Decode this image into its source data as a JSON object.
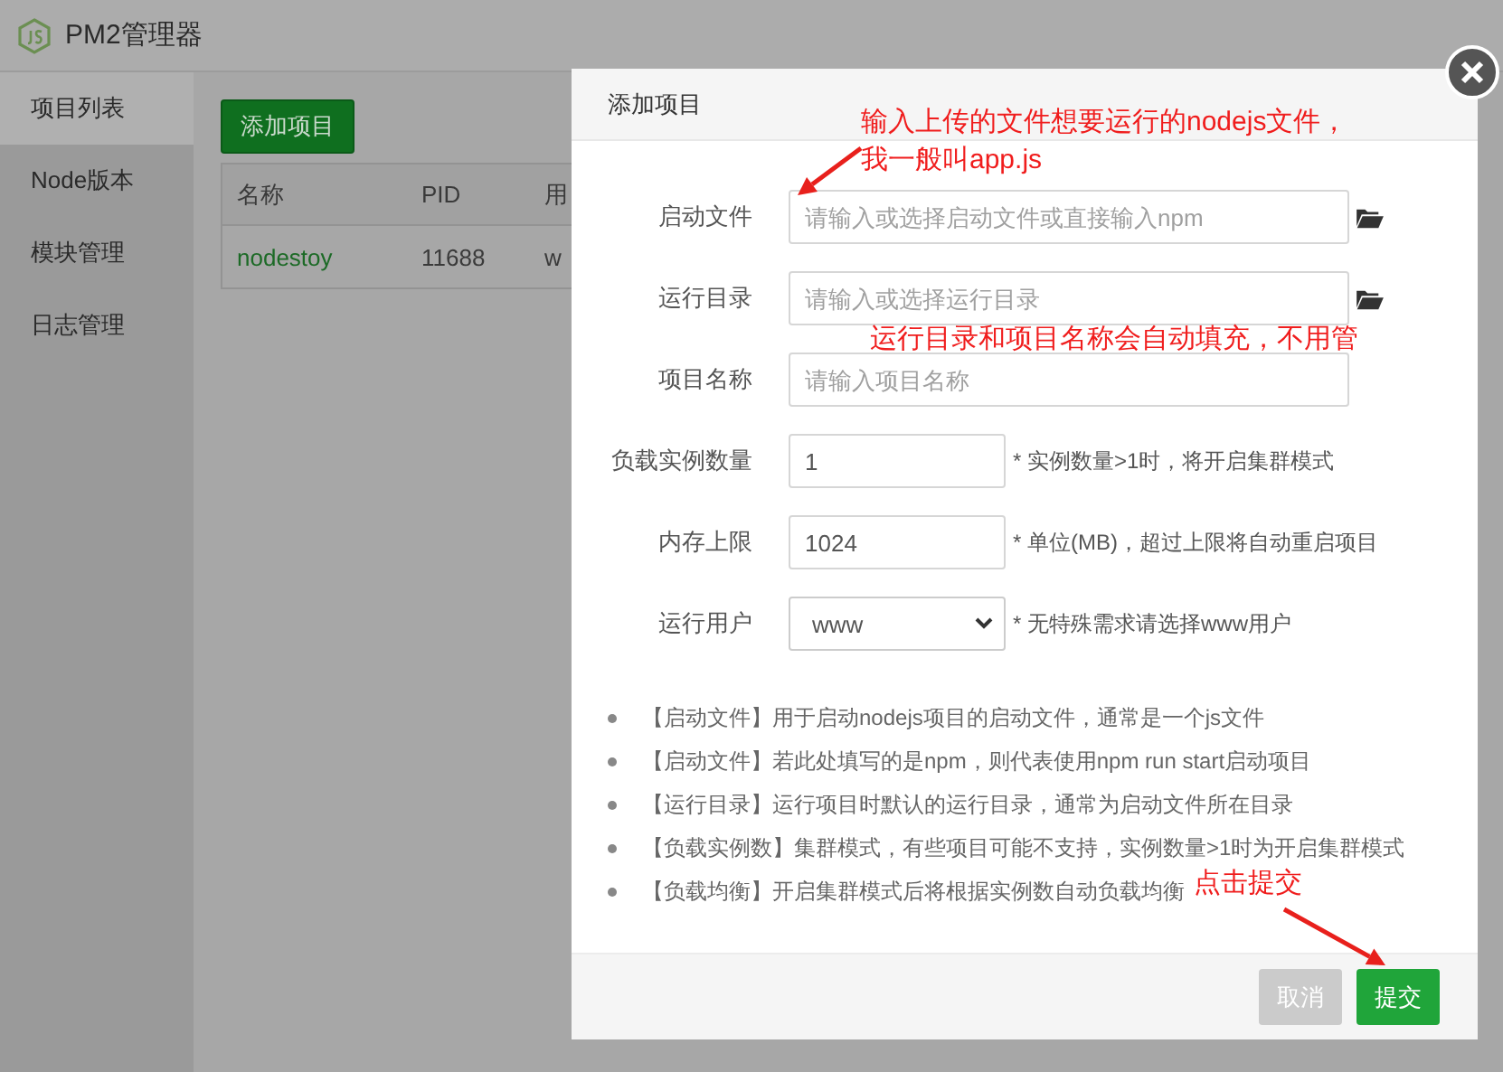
{
  "app": {
    "title": "PM2管理器"
  },
  "sidebar": {
    "items": [
      {
        "label": "项目列表",
        "selected": true
      },
      {
        "label": "Node版本",
        "selected": false
      },
      {
        "label": "模块管理",
        "selected": false
      },
      {
        "label": "日志管理",
        "selected": false
      }
    ]
  },
  "toolbar": {
    "add_button": "添加项目"
  },
  "table": {
    "columns": [
      "名称",
      "PID",
      "用"
    ],
    "rows": [
      [
        "nodestoy",
        "11688",
        "w"
      ]
    ]
  },
  "dialog": {
    "title": "添加项目",
    "fields": [
      {
        "kind": "file",
        "label": "启动文件",
        "placeholder": "请输入或选择启动文件或直接输入npm"
      },
      {
        "kind": "file",
        "label": "运行目录",
        "placeholder": "请输入或选择运行目录"
      },
      {
        "kind": "text",
        "label": "项目名称",
        "placeholder": "请输入项目名称"
      },
      {
        "kind": "short",
        "label": "负载实例数量",
        "value": "1",
        "hint": "* 实例数量>1时，将开启集群模式"
      },
      {
        "kind": "short",
        "label": "内存上限",
        "value": "1024",
        "hint": "* 单位(MB)，超过上限将自动重启项目"
      },
      {
        "kind": "select",
        "label": "运行用户",
        "value": "www",
        "hint": "* 无特殊需求请选择www用户"
      }
    ],
    "notes": [
      "【启动文件】用于启动nodejs项目的启动文件，通常是一个js文件",
      "【启动文件】若此处填写的是npm，则代表使用npm run start启动项目",
      "【运行目录】运行项目时默认的运行目录，通常为启动文件所在目录",
      "【负载实例数】集群模式，有些项目可能不支持，实例数量>1时为开启集群模式",
      "【负载均衡】开启集群模式后将根据实例数自动负载均衡"
    ],
    "buttons": [
      {
        "kind": "cancel",
        "label": "取消"
      },
      {
        "kind": "primary",
        "label": "提交"
      }
    ]
  },
  "annotations": [
    {
      "kind": "callout",
      "lines": [
        "输入上传的文件想要运行的nodejs文件，",
        "我一般叫app.js"
      ]
    },
    {
      "kind": "label",
      "lines": [
        "运行目录和项目名称会自动填充，不用管"
      ]
    },
    {
      "kind": "callout",
      "lines": [
        "点击提交"
      ]
    }
  ]
}
